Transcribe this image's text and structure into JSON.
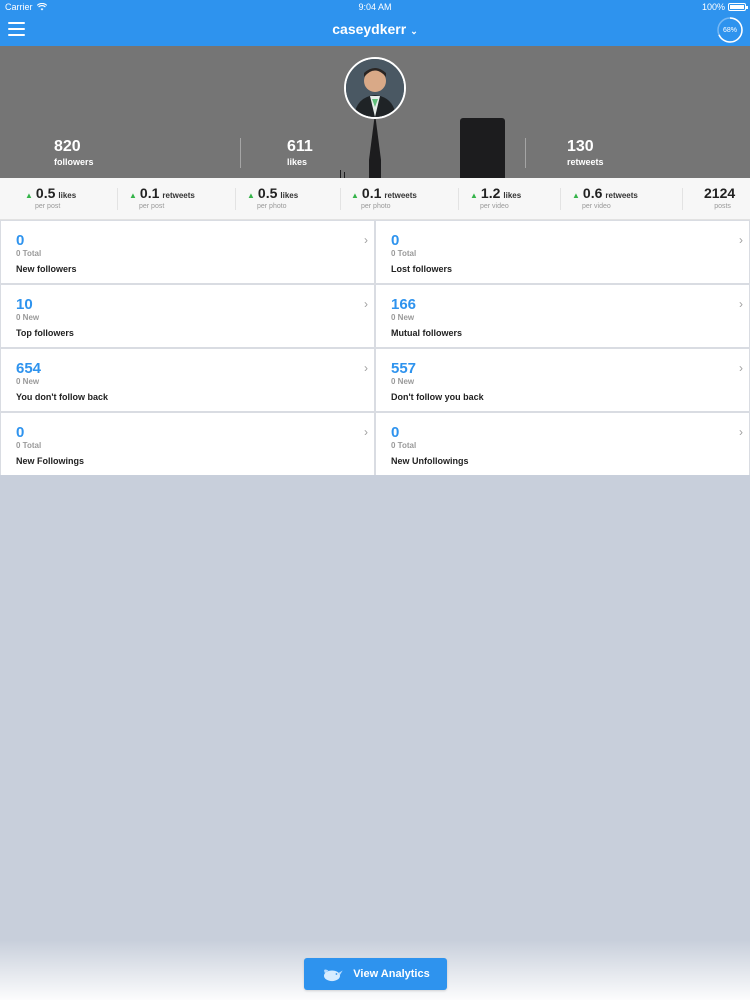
{
  "status_bar": {
    "carrier": "Carrier",
    "time": "9:04 AM",
    "battery": "100%",
    "battery_level": 1.0
  },
  "header": {
    "username": "caseydkerr",
    "progress_label": "68%",
    "progress_value": 0.68
  },
  "profile": {
    "stats": [
      {
        "value": "820",
        "label": "followers"
      },
      {
        "value": "611",
        "label": "likes"
      },
      {
        "value": "130",
        "label": "retweets"
      }
    ]
  },
  "metrics": [
    {
      "value": "0.5",
      "unit": "likes",
      "sub": "per post"
    },
    {
      "value": "0.1",
      "unit": "retweets",
      "sub": "per post"
    },
    {
      "value": "0.5",
      "unit": "likes",
      "sub": "per photo"
    },
    {
      "value": "0.1",
      "unit": "retweets",
      "sub": "per photo"
    },
    {
      "value": "1.2",
      "unit": "likes",
      "sub": "per video"
    },
    {
      "value": "0.6",
      "unit": "retweets",
      "sub": "per video"
    }
  ],
  "posts": {
    "value": "2124",
    "label": "posts"
  },
  "cards": [
    {
      "value": "0",
      "sub": "0 Total",
      "label": "New followers"
    },
    {
      "value": "0",
      "sub": "0 Total",
      "label": "Lost followers"
    },
    {
      "value": "10",
      "sub": "0 New",
      "label": "Top followers"
    },
    {
      "value": "166",
      "sub": "0 New",
      "label": "Mutual followers"
    },
    {
      "value": "654",
      "sub": "0 New",
      "label": "You don't follow back"
    },
    {
      "value": "557",
      "sub": "0 New",
      "label": "Don't follow you back"
    },
    {
      "value": "0",
      "sub": "0 Total",
      "label": "New Followings"
    },
    {
      "value": "0",
      "sub": "0 Total",
      "label": "New Unfollowings"
    }
  ],
  "cta": {
    "label": "View Analytics"
  },
  "colors": {
    "accent": "#2e93ee",
    "up_arrow": "#35b44a",
    "background": "#c8cfdb"
  }
}
